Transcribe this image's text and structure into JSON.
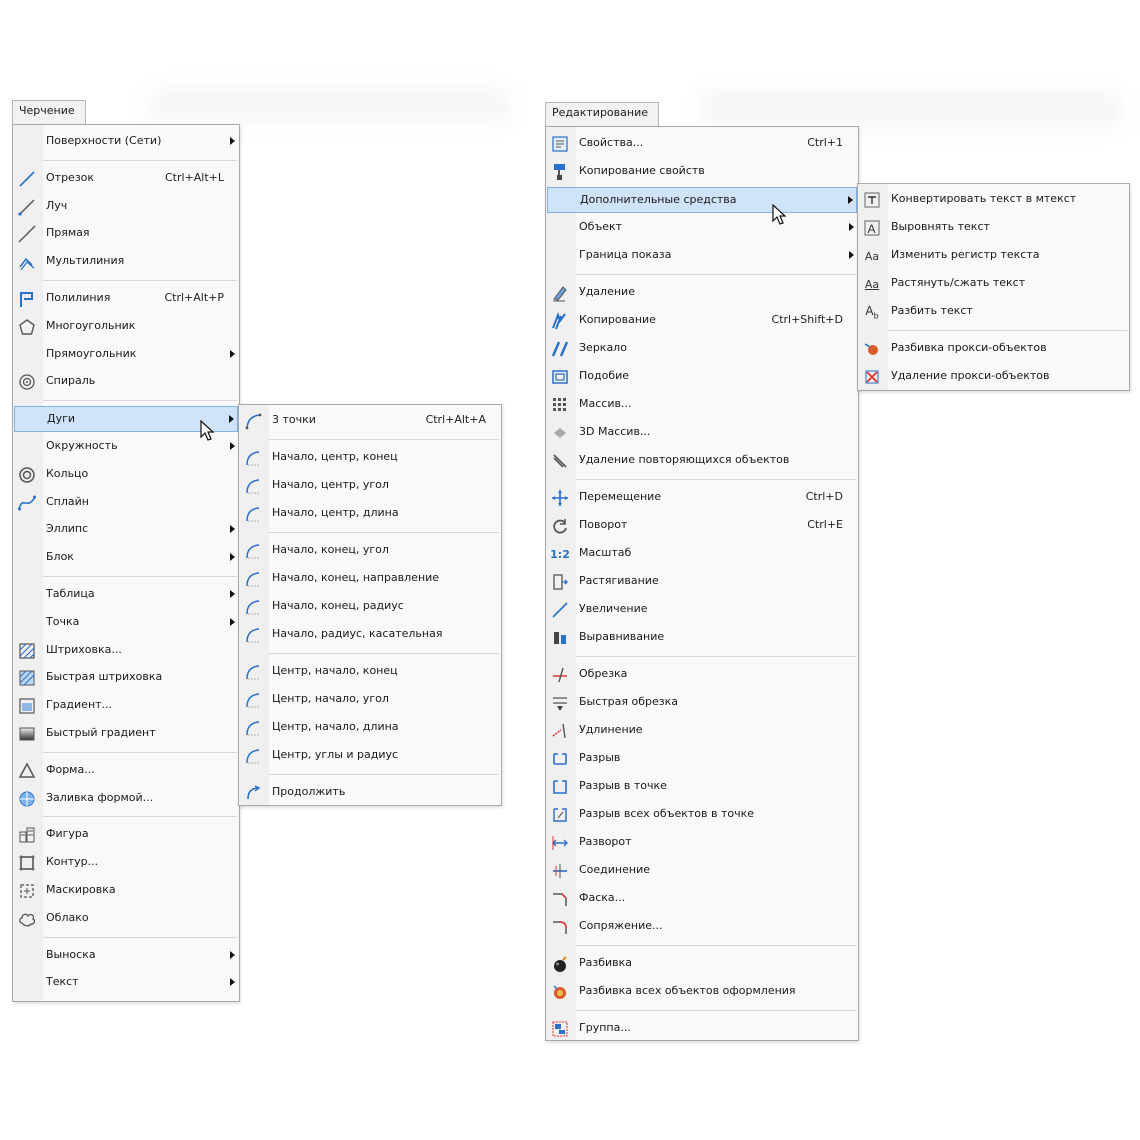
{
  "drawing_menu": {
    "tab": "Черчение",
    "items": [
      {
        "label": "Поверхности (Сети)",
        "sub": true,
        "icon": ""
      },
      {
        "sep": true
      },
      {
        "label": "Отрезок",
        "shortcut": "Ctrl+Alt+L",
        "icon": "line-icon"
      },
      {
        "label": "Луч",
        "icon": "ray-icon"
      },
      {
        "label": "Прямая",
        "icon": "xline-icon"
      },
      {
        "label": "Мультилиния",
        "icon": "multiline-icon"
      },
      {
        "sep": true
      },
      {
        "label": "Полилиния",
        "shortcut": "Ctrl+Alt+P",
        "icon": "polyline-icon"
      },
      {
        "label": "Многоугольник",
        "icon": "polygon-icon"
      },
      {
        "label": "Прямоугольник",
        "sub": true,
        "icon": ""
      },
      {
        "label": "Спираль",
        "icon": "spiral-icon"
      },
      {
        "sep": true
      },
      {
        "label": "Дуги",
        "sub": true,
        "highlight": true,
        "icon": ""
      },
      {
        "label": "Окружность",
        "sub": true,
        "icon": ""
      },
      {
        "label": "Кольцо",
        "icon": "donut-icon"
      },
      {
        "label": "Сплайн",
        "icon": "spline-icon"
      },
      {
        "label": "Эллипс",
        "sub": true,
        "icon": ""
      },
      {
        "label": "Блок",
        "sub": true,
        "icon": ""
      },
      {
        "sep": true
      },
      {
        "label": "Таблица",
        "sub": true,
        "icon": ""
      },
      {
        "label": "Точка",
        "sub": true,
        "icon": ""
      },
      {
        "label": "Штриховка...",
        "icon": "hatch-icon"
      },
      {
        "label": "Быстрая штриховка",
        "icon": "quick-hatch-icon"
      },
      {
        "label": "Градиент...",
        "icon": "gradient-icon"
      },
      {
        "label": "Быстрый градиент",
        "icon": "quick-gradient-icon"
      },
      {
        "sep": true
      },
      {
        "label": "Форма...",
        "icon": "shape-icon"
      },
      {
        "label": "Заливка формой...",
        "icon": "shape-fill-icon"
      },
      {
        "sep": true
      },
      {
        "label": "Фигура",
        "icon": "figure-icon"
      },
      {
        "label": "Контур...",
        "icon": "boundary-icon"
      },
      {
        "label": "Маскировка",
        "icon": "wipeout-icon"
      },
      {
        "label": "Облако",
        "icon": "cloud-icon"
      },
      {
        "sep": true
      },
      {
        "label": "Выноска",
        "sub": true,
        "icon": ""
      },
      {
        "label": "Текст",
        "sub": true,
        "icon": ""
      }
    ]
  },
  "arcs_menu": {
    "items": [
      {
        "label": "3 точки",
        "shortcut": "Ctrl+Alt+A",
        "icon": "arc-3points-icon"
      },
      {
        "sep": true
      },
      {
        "label": "Начало, центр, конец",
        "icon": "arc-icon"
      },
      {
        "label": "Начало, центр, угол",
        "icon": "arc-icon"
      },
      {
        "label": "Начало, центр, длина",
        "icon": "arc-icon"
      },
      {
        "sep": true
      },
      {
        "label": "Начало, конец, угол",
        "icon": "arc-icon"
      },
      {
        "label": "Начало, конец, направление",
        "icon": "arc-icon"
      },
      {
        "label": "Начало, конец, радиус",
        "icon": "arc-icon"
      },
      {
        "label": "Начало, радиус, касательная",
        "icon": "arc-icon"
      },
      {
        "sep": true
      },
      {
        "label": "Центр, начало, конец",
        "icon": "arc-icon"
      },
      {
        "label": "Центр, начало, угол",
        "icon": "arc-icon"
      },
      {
        "label": "Центр, начало, длина",
        "icon": "arc-icon"
      },
      {
        "label": "Центр, углы и радиус",
        "icon": "arc-icon"
      },
      {
        "sep": true
      },
      {
        "label": "Продолжить",
        "icon": "arc-continue-icon"
      }
    ]
  },
  "edit_menu": {
    "tab": "Редактирование",
    "items": [
      {
        "label": "Свойства...",
        "shortcut": "Ctrl+1",
        "icon": "properties-icon"
      },
      {
        "label": "Копирование свойств",
        "icon": "match-properties-icon"
      },
      {
        "label": "Дополнительные средства",
        "sub": true,
        "highlight": true,
        "icon": ""
      },
      {
        "label": "Объект",
        "sub": true,
        "icon": ""
      },
      {
        "label": "Граница показа",
        "sub": true,
        "icon": ""
      },
      {
        "sep": true
      },
      {
        "label": "Удаление",
        "icon": "erase-icon"
      },
      {
        "label": "Копирование",
        "shortcut": "Ctrl+Shift+D",
        "icon": "copy-icon"
      },
      {
        "label": "Зеркало",
        "icon": "mirror-icon"
      },
      {
        "label": "Подобие",
        "icon": "offset-icon"
      },
      {
        "label": "Массив...",
        "icon": "array-icon"
      },
      {
        "label": "3D Массив...",
        "icon": "3d-array-icon"
      },
      {
        "label": "Удаление повторяющихся объектов",
        "icon": "overkill-icon"
      },
      {
        "sep": true
      },
      {
        "label": "Перемещение",
        "shortcut": "Ctrl+D",
        "icon": "move-icon"
      },
      {
        "label": "Поворот",
        "shortcut": "Ctrl+E",
        "icon": "rotate-icon"
      },
      {
        "label": "Масштаб",
        "icon": "scale-icon"
      },
      {
        "label": "Растягивание",
        "icon": "stretch-icon"
      },
      {
        "label": "Увеличение",
        "icon": "lengthen-icon"
      },
      {
        "label": "Выравнивание",
        "icon": "align-icon"
      },
      {
        "sep": true
      },
      {
        "label": "Обрезка",
        "icon": "trim-icon"
      },
      {
        "label": "Быстрая обрезка",
        "icon": "quick-trim-icon"
      },
      {
        "label": "Удлинение",
        "icon": "extend-icon"
      },
      {
        "label": "Разрыв",
        "icon": "break-icon"
      },
      {
        "label": "Разрыв в точке",
        "icon": "break-at-point-icon"
      },
      {
        "label": "Разрыв всех объектов в точке",
        "icon": "break-all-icon"
      },
      {
        "label": "Разворот",
        "icon": "reverse-icon"
      },
      {
        "label": "Соединение",
        "icon": "join-icon"
      },
      {
        "label": "Фаска...",
        "icon": "chamfer-icon"
      },
      {
        "label": "Сопряжение...",
        "icon": "fillet-icon"
      },
      {
        "sep": true
      },
      {
        "label": "Разбивка",
        "icon": "explode-icon"
      },
      {
        "label": "Разбивка всех объектов оформления",
        "icon": "explode-all-icon"
      },
      {
        "sep": true
      },
      {
        "label": "Группа...",
        "icon": "group-icon"
      }
    ]
  },
  "tools_menu": {
    "items": [
      {
        "label": "Конвертировать текст в мтекст",
        "icon": "convert-text-icon"
      },
      {
        "label": "Выровнять текст",
        "icon": "align-text-icon"
      },
      {
        "label": "Изменить регистр текста",
        "icon": "text-case-icon"
      },
      {
        "label": "Растянуть/сжать текст",
        "icon": "stretch-text-icon"
      },
      {
        "label": "Разбить текст",
        "icon": "split-text-icon"
      },
      {
        "sep": true
      },
      {
        "label": "Разбивка прокси-объектов",
        "icon": "explode-proxy-icon"
      },
      {
        "label": "Удаление прокси-объектов",
        "icon": "remove-proxy-icon"
      }
    ]
  }
}
